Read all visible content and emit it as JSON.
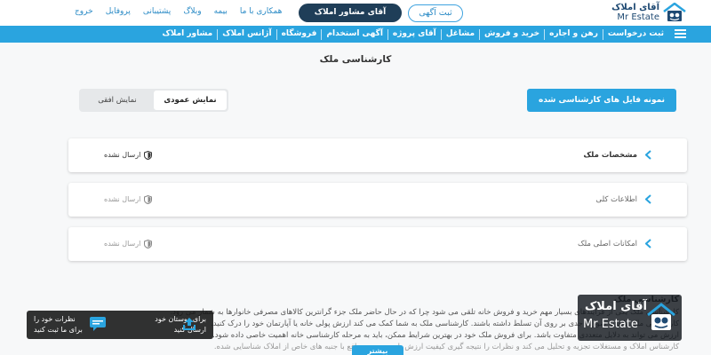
{
  "header": {
    "logo_fa": "آقای املاک",
    "logo_en": "Mr Estate",
    "post_ad_label": "ثبت آگهی",
    "advisor_label": "آقای مشاور املاک",
    "links": [
      "همکاری با ما",
      "بیمه",
      "وبلاگ",
      "پشتیبانی",
      "پروفایل",
      "خروج"
    ]
  },
  "nav": {
    "items": [
      "ثبت درخواست",
      "رهن و اجاره",
      "خرید و فروش",
      "مشاغل",
      "آقای پروژه",
      "آگهی استخدام",
      "فروشگاه",
      "آژانس املاک",
      "مشاور املاک"
    ]
  },
  "page": {
    "title": "کارشناسی ملک",
    "sample_button": "نمونه فایل های کارشناسی شده",
    "view_vertical": "نمایش عمودی",
    "view_horizontal": "نمایش افقی"
  },
  "sections": [
    {
      "title": "مشخصات ملک",
      "status": "ارسال نشده",
      "active": true
    },
    {
      "title": "اطلاعات کلی",
      "status": "ارسال نشده",
      "active": false
    },
    {
      "title": "امکانات اصلی ملک",
      "status": "ارسال نشده",
      "active": false
    }
  ],
  "article": {
    "heading": "کارشناسی ملک",
    "line1": "کارشناسی ملک یکی از فرایندهای بسیار مهم خرید و فروش خانه تلقی می شود چرا که در حال حاضر ملک جزء گرانترین کالاهای مصرفی خانوارها به شمار می رود.",
    "line2": "کارشناسی ملک باید به صورت جدی بر روی آن تسلط داشته باشند. کارشناسی ملک به شما کمک می کند ارزش پولی خانه یا آپارتمان خود را درک کنید.",
    "line3": "ارزش می تواند به دلایل متعددی متفاوت باشد. برای فروش ملک خود در بهترین شرایط ممکن، باید به مرحله کارشناسی خانه اهمیت خاصی داده شود.",
    "line4": "کارشناس املاک و مستغلات تجزیه و تحلیل می کند و نظرات را نتیجه گیری کیفیت ارزش با سودمندی منافع با جنبه های خاص از املاک شناسایی شده.",
    "more_label": "بیشتر"
  },
  "overlay": {
    "brand_fa": "آقای املاک",
    "brand_en": "Mr Estate",
    "share_line1": "برای دوستان خود",
    "share_line2": "ارسال کنید",
    "comment_line1": "نظرات خود را",
    "comment_line2": "برای ما ثبت کنید"
  },
  "colors": {
    "accent_blue": "#2aa4df",
    "dark_navy": "#1f3e58"
  },
  "icons": [
    "logo-house-icon",
    "hamburger-icon",
    "chevron-left-icon",
    "shield-icon",
    "share-icon",
    "comment-icon"
  ]
}
